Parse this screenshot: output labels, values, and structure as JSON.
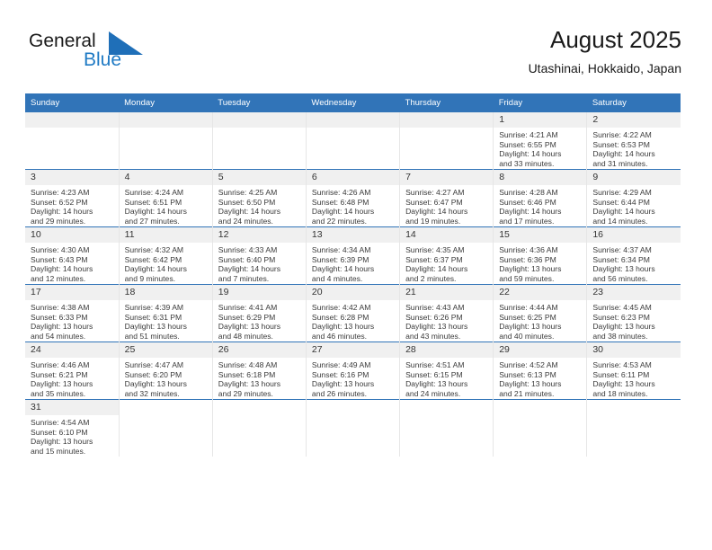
{
  "brand": {
    "name_part1": "General",
    "name_part2": "Blue",
    "flag_icon": "blue-pennant-icon",
    "accent_color": "#1f7ac4"
  },
  "header": {
    "title": "August 2025",
    "subtitle": "Utashinai, Hokkaido, Japan"
  },
  "theme": {
    "header_blue": "#3174b8",
    "daynum_band": "#f0f0f0",
    "grid_line": "#e6e6e6"
  },
  "weekdays": [
    "Sunday",
    "Monday",
    "Tuesday",
    "Wednesday",
    "Thursday",
    "Friday",
    "Saturday"
  ],
  "labels": {
    "sunrise_prefix": "Sunrise:",
    "sunset_prefix": "Sunset:",
    "daylight_prefix": "Daylight:"
  },
  "weeks": [
    [
      {
        "blank": true
      },
      {
        "blank": true
      },
      {
        "blank": true
      },
      {
        "blank": true
      },
      {
        "blank": true
      },
      {
        "day": "1",
        "sunrise": "Sunrise: 4:21 AM",
        "sunset": "Sunset: 6:55 PM",
        "daylight1": "Daylight: 14 hours",
        "daylight2": "and 33 minutes."
      },
      {
        "day": "2",
        "sunrise": "Sunrise: 4:22 AM",
        "sunset": "Sunset: 6:53 PM",
        "daylight1": "Daylight: 14 hours",
        "daylight2": "and 31 minutes."
      }
    ],
    [
      {
        "day": "3",
        "sunrise": "Sunrise: 4:23 AM",
        "sunset": "Sunset: 6:52 PM",
        "daylight1": "Daylight: 14 hours",
        "daylight2": "and 29 minutes."
      },
      {
        "day": "4",
        "sunrise": "Sunrise: 4:24 AM",
        "sunset": "Sunset: 6:51 PM",
        "daylight1": "Daylight: 14 hours",
        "daylight2": "and 27 minutes."
      },
      {
        "day": "5",
        "sunrise": "Sunrise: 4:25 AM",
        "sunset": "Sunset: 6:50 PM",
        "daylight1": "Daylight: 14 hours",
        "daylight2": "and 24 minutes."
      },
      {
        "day": "6",
        "sunrise": "Sunrise: 4:26 AM",
        "sunset": "Sunset: 6:48 PM",
        "daylight1": "Daylight: 14 hours",
        "daylight2": "and 22 minutes."
      },
      {
        "day": "7",
        "sunrise": "Sunrise: 4:27 AM",
        "sunset": "Sunset: 6:47 PM",
        "daylight1": "Daylight: 14 hours",
        "daylight2": "and 19 minutes."
      },
      {
        "day": "8",
        "sunrise": "Sunrise: 4:28 AM",
        "sunset": "Sunset: 6:46 PM",
        "daylight1": "Daylight: 14 hours",
        "daylight2": "and 17 minutes."
      },
      {
        "day": "9",
        "sunrise": "Sunrise: 4:29 AM",
        "sunset": "Sunset: 6:44 PM",
        "daylight1": "Daylight: 14 hours",
        "daylight2": "and 14 minutes."
      }
    ],
    [
      {
        "day": "10",
        "sunrise": "Sunrise: 4:30 AM",
        "sunset": "Sunset: 6:43 PM",
        "daylight1": "Daylight: 14 hours",
        "daylight2": "and 12 minutes."
      },
      {
        "day": "11",
        "sunrise": "Sunrise: 4:32 AM",
        "sunset": "Sunset: 6:42 PM",
        "daylight1": "Daylight: 14 hours",
        "daylight2": "and 9 minutes."
      },
      {
        "day": "12",
        "sunrise": "Sunrise: 4:33 AM",
        "sunset": "Sunset: 6:40 PM",
        "daylight1": "Daylight: 14 hours",
        "daylight2": "and 7 minutes."
      },
      {
        "day": "13",
        "sunrise": "Sunrise: 4:34 AM",
        "sunset": "Sunset: 6:39 PM",
        "daylight1": "Daylight: 14 hours",
        "daylight2": "and 4 minutes."
      },
      {
        "day": "14",
        "sunrise": "Sunrise: 4:35 AM",
        "sunset": "Sunset: 6:37 PM",
        "daylight1": "Daylight: 14 hours",
        "daylight2": "and 2 minutes."
      },
      {
        "day": "15",
        "sunrise": "Sunrise: 4:36 AM",
        "sunset": "Sunset: 6:36 PM",
        "daylight1": "Daylight: 13 hours",
        "daylight2": "and 59 minutes."
      },
      {
        "day": "16",
        "sunrise": "Sunrise: 4:37 AM",
        "sunset": "Sunset: 6:34 PM",
        "daylight1": "Daylight: 13 hours",
        "daylight2": "and 56 minutes."
      }
    ],
    [
      {
        "day": "17",
        "sunrise": "Sunrise: 4:38 AM",
        "sunset": "Sunset: 6:33 PM",
        "daylight1": "Daylight: 13 hours",
        "daylight2": "and 54 minutes."
      },
      {
        "day": "18",
        "sunrise": "Sunrise: 4:39 AM",
        "sunset": "Sunset: 6:31 PM",
        "daylight1": "Daylight: 13 hours",
        "daylight2": "and 51 minutes."
      },
      {
        "day": "19",
        "sunrise": "Sunrise: 4:41 AM",
        "sunset": "Sunset: 6:29 PM",
        "daylight1": "Daylight: 13 hours",
        "daylight2": "and 48 minutes."
      },
      {
        "day": "20",
        "sunrise": "Sunrise: 4:42 AM",
        "sunset": "Sunset: 6:28 PM",
        "daylight1": "Daylight: 13 hours",
        "daylight2": "and 46 minutes."
      },
      {
        "day": "21",
        "sunrise": "Sunrise: 4:43 AM",
        "sunset": "Sunset: 6:26 PM",
        "daylight1": "Daylight: 13 hours",
        "daylight2": "and 43 minutes."
      },
      {
        "day": "22",
        "sunrise": "Sunrise: 4:44 AM",
        "sunset": "Sunset: 6:25 PM",
        "daylight1": "Daylight: 13 hours",
        "daylight2": "and 40 minutes."
      },
      {
        "day": "23",
        "sunrise": "Sunrise: 4:45 AM",
        "sunset": "Sunset: 6:23 PM",
        "daylight1": "Daylight: 13 hours",
        "daylight2": "and 38 minutes."
      }
    ],
    [
      {
        "day": "24",
        "sunrise": "Sunrise: 4:46 AM",
        "sunset": "Sunset: 6:21 PM",
        "daylight1": "Daylight: 13 hours",
        "daylight2": "and 35 minutes."
      },
      {
        "day": "25",
        "sunrise": "Sunrise: 4:47 AM",
        "sunset": "Sunset: 6:20 PM",
        "daylight1": "Daylight: 13 hours",
        "daylight2": "and 32 minutes."
      },
      {
        "day": "26",
        "sunrise": "Sunrise: 4:48 AM",
        "sunset": "Sunset: 6:18 PM",
        "daylight1": "Daylight: 13 hours",
        "daylight2": "and 29 minutes."
      },
      {
        "day": "27",
        "sunrise": "Sunrise: 4:49 AM",
        "sunset": "Sunset: 6:16 PM",
        "daylight1": "Daylight: 13 hours",
        "daylight2": "and 26 minutes."
      },
      {
        "day": "28",
        "sunrise": "Sunrise: 4:51 AM",
        "sunset": "Sunset: 6:15 PM",
        "daylight1": "Daylight: 13 hours",
        "daylight2": "and 24 minutes."
      },
      {
        "day": "29",
        "sunrise": "Sunrise: 4:52 AM",
        "sunset": "Sunset: 6:13 PM",
        "daylight1": "Daylight: 13 hours",
        "daylight2": "and 21 minutes."
      },
      {
        "day": "30",
        "sunrise": "Sunrise: 4:53 AM",
        "sunset": "Sunset: 6:11 PM",
        "daylight1": "Daylight: 13 hours",
        "daylight2": "and 18 minutes."
      }
    ],
    [
      {
        "day": "31",
        "sunrise": "Sunrise: 4:54 AM",
        "sunset": "Sunset: 6:10 PM",
        "daylight1": "Daylight: 13 hours",
        "daylight2": "and 15 minutes."
      },
      {
        "blank": true
      },
      {
        "blank": true
      },
      {
        "blank": true
      },
      {
        "blank": true
      },
      {
        "blank": true
      },
      {
        "blank": true
      }
    ]
  ]
}
